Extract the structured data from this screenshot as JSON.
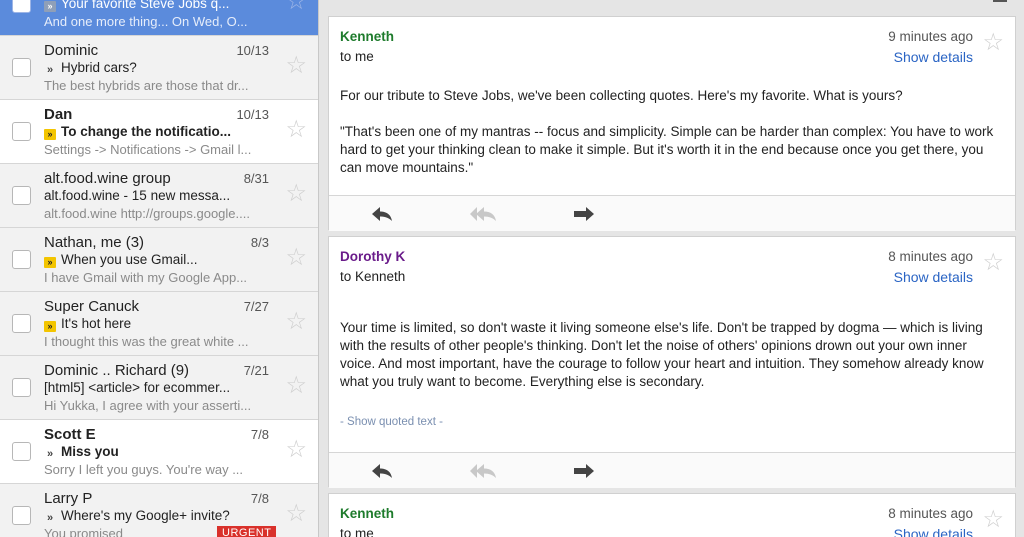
{
  "list": {
    "items": [
      {
        "sender": "",
        "date": "",
        "marker": "gray",
        "subject": "Your favorite Steve Jobs q...",
        "snippet": "And one more thing... On Wed, O...",
        "unread": false,
        "selected": true,
        "urgent": ""
      },
      {
        "sender": "Dominic",
        "date": "10/13",
        "marker": "plain",
        "subject": "Hybrid cars?",
        "snippet": "The best hybrids are those that dr...",
        "unread": false,
        "selected": false,
        "urgent": ""
      },
      {
        "sender": "Dan",
        "date": "10/13",
        "marker": "yel",
        "subject": "To change the notificatio...",
        "snippet": "Settings -> Notifications -> Gmail l...",
        "unread": true,
        "selected": false,
        "urgent": ""
      },
      {
        "sender": "alt.food.wine group",
        "date": "8/31",
        "marker": "",
        "subject": "alt.food.wine - 15 new messa...",
        "snippet": "alt.food.wine http://groups.google....",
        "unread": false,
        "selected": false,
        "urgent": ""
      },
      {
        "sender": "Nathan, me (3)",
        "date": "8/3",
        "marker": "yel",
        "subject": "When you use Gmail...",
        "snippet": "I have Gmail with my Google App...",
        "unread": false,
        "selected": false,
        "urgent": ""
      },
      {
        "sender": "Super Canuck",
        "date": "7/27",
        "marker": "yel",
        "subject": "It's hot here",
        "snippet": "I thought this was the great white ...",
        "unread": false,
        "selected": false,
        "urgent": ""
      },
      {
        "sender": "Dominic .. Richard (9)",
        "date": "7/21",
        "marker": "",
        "subject": "[html5] <article> for ecommer...",
        "snippet": "Hi Yukka, I agree with your asserti...",
        "unread": false,
        "selected": false,
        "urgent": ""
      },
      {
        "sender": "Scott E",
        "date": "7/8",
        "marker": "plain",
        "subject": "Miss you",
        "snippet": "Sorry I left you guys. You're way ...",
        "unread": true,
        "selected": false,
        "urgent": ""
      },
      {
        "sender": "Larry P",
        "date": "7/8",
        "marker": "plain",
        "subject": "Where's my Google+ invite?",
        "snippet": "You promised",
        "unread": false,
        "selected": false,
        "urgent": "URGENT"
      }
    ]
  },
  "thread": {
    "messages": [
      {
        "from": "Kenneth",
        "from_color": "#1e7b2c",
        "to": "to me",
        "time": "9 minutes ago",
        "details": "Show details",
        "paragraphs": [
          "For our tribute to Steve Jobs, we've been collecting quotes. Here's my favorite. What is yours?",
          "\"That's been one of my mantras -- focus and simplicity. Simple can be harder than complex: You have to work hard to get your thinking clean to make it simple. But it's worth it in the end because once you get there, you can move mountains.\""
        ],
        "quoted": ""
      },
      {
        "from": "Dorothy K",
        "from_color": "#6a1b8a",
        "to": "to Kenneth",
        "time": "8 minutes ago",
        "details": "Show details",
        "paragraphs": [
          "Your time is limited, so don't waste it living someone else's life. Don't be trapped by dogma — which is living with the results of other people's thinking. Don't let the noise of others' opinions drown out your own inner voice. And most important, have the courage to follow your heart and intuition. They somehow already know what you truly want to become. Everything else is secondary."
        ],
        "quoted": "- Show quoted text -"
      },
      {
        "from": "Kenneth",
        "from_color": "#1e7b2c",
        "to": "to me",
        "time": "8 minutes ago",
        "details": "Show details",
        "paragraphs": [],
        "quoted": ""
      }
    ]
  },
  "icons": {
    "reply": "reply-arrow",
    "reply_all": "reply-all-double-arrow",
    "forward": "forward-arrow",
    "star": "star-outline",
    "checkbox": "empty-checkbox"
  },
  "colors": {
    "selected_row": "#5b8bdc",
    "link": "#2a64c4",
    "urgent": "#d9312b",
    "label_marker": "#f3c500"
  }
}
